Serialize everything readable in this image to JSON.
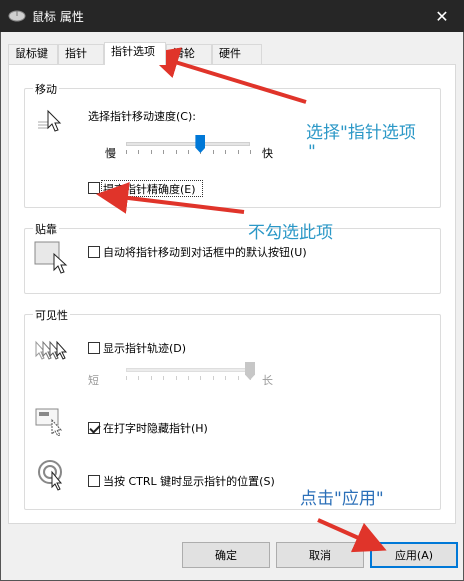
{
  "window": {
    "title": "鼠标 属性",
    "close_glyph": "✕"
  },
  "tabs": [
    {
      "label": "鼠标键"
    },
    {
      "label": "指针"
    },
    {
      "label": "指针选项",
      "active": true
    },
    {
      "label": "滑轮"
    },
    {
      "label": "硬件"
    }
  ],
  "motion": {
    "title": "移动",
    "speed_label": "选择指针移动速度(C):",
    "slow_label": "慢",
    "fast_label": "快",
    "speed_level": 0.6,
    "precision_label": "提高指针精确度(E)",
    "precision_checked": false
  },
  "snap": {
    "title": "贴靠",
    "label": "自动将指针移动到对话框中的默认按钮(U)",
    "checked": false
  },
  "visibility": {
    "title": "可见性",
    "trails_label": "显示指针轨迹(D)",
    "trails_checked": false,
    "short_label": "短",
    "long_label": "长",
    "trail_level": 1.0,
    "hide_label": "在打字时隐藏指针(H)",
    "hide_checked": true,
    "ctrl_label": "当按 CTRL 键时显示指针的位置(S)",
    "ctrl_checked": false
  },
  "buttons": {
    "ok": "确定",
    "cancel": "取消",
    "apply": "应用(A)"
  },
  "annotations": {
    "select_option": "选择\"指针选项",
    "select_option_tail": "\"",
    "uncheck": "不勾选此项",
    "click_apply": "点击\"应用\""
  },
  "colors": {
    "accent": "#0078d7",
    "annotation": "#2c98c7",
    "arrow": "#e0342a"
  }
}
